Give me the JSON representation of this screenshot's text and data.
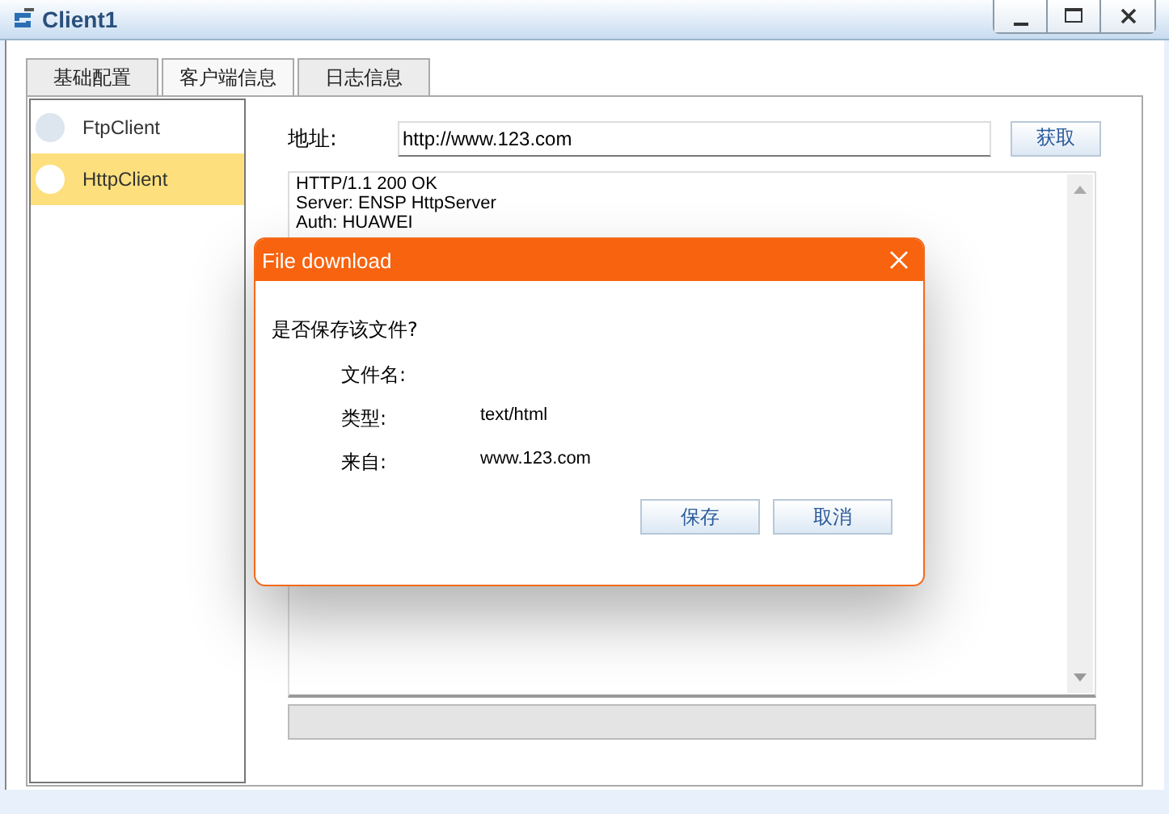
{
  "window": {
    "title": "Client1"
  },
  "tabs": [
    {
      "label": "基础配置",
      "selected": false
    },
    {
      "label": "客户端信息",
      "selected": true
    },
    {
      "label": "日志信息",
      "selected": false
    }
  ],
  "sidebar": {
    "items": [
      {
        "label": "FtpClient",
        "selected": false
      },
      {
        "label": "HttpClient",
        "selected": true
      }
    ]
  },
  "address": {
    "label": "地址:",
    "value": "http://www.123.com",
    "button": "获取"
  },
  "response": {
    "lines": [
      "HTTP/1.1 200 OK",
      "Server: ENSP HttpServer",
      "Auth: HUAWEI"
    ]
  },
  "progress": {
    "level": 0
  },
  "dialog": {
    "title": "File download",
    "question": "是否保存该文件?",
    "fields": [
      {
        "label": "文件名:"
      },
      {
        "label": "类型:",
        "value": "text/html"
      },
      {
        "label": "来自:",
        "value": "www.123.com"
      }
    ],
    "buttons": [
      "保存",
      "取消"
    ]
  }
}
